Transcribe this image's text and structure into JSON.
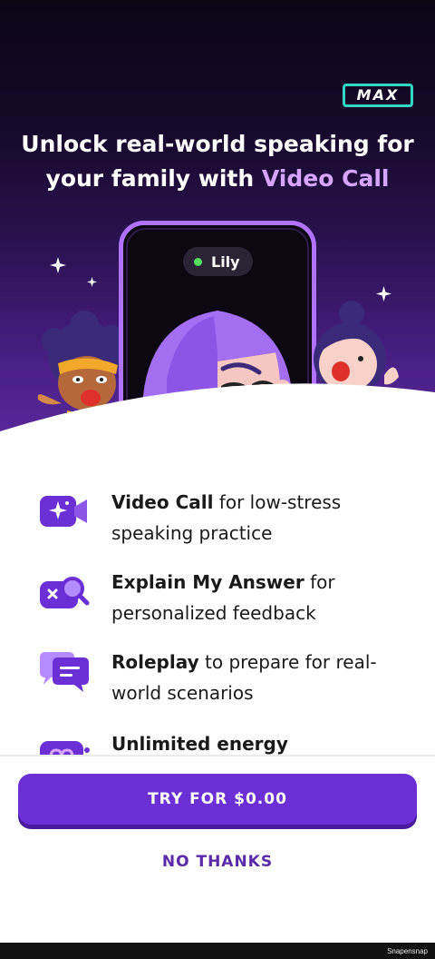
{
  "badge": {
    "label": "MAX"
  },
  "headline": {
    "line1": "Unlock real-world speaking for",
    "line2_prefix": "your family with ",
    "line2_accent": "Video Call"
  },
  "phone": {
    "caller_name": "Lily"
  },
  "features": [
    {
      "icon": "video-camera-sparkle-icon",
      "title": "Video Call",
      "rest_line1": " for low-stress",
      "line2": "speaking practice"
    },
    {
      "icon": "explain-magnifier-icon",
      "title": "Explain My Answer",
      "rest_line1": " for",
      "line2": "personalized feedback"
    },
    {
      "icon": "chat-bubbles-icon",
      "title": "Roleplay",
      "rest_line1": " to prepare for real-",
      "line2": "world scenarios"
    },
    {
      "icon": "infinite-energy-icon",
      "title": "Unlimited energy",
      "rest_line1": "",
      "line2": ""
    }
  ],
  "actions": {
    "try_label": "TRY FOR $0.00",
    "no_thanks_label": "NO THANKS"
  },
  "watermark": "Snapensnap",
  "colors": {
    "primary": "#6b2fd6",
    "accent_text": "#d6a6ff",
    "badge_border": "#33d6c4",
    "link": "#5a2aa8"
  }
}
